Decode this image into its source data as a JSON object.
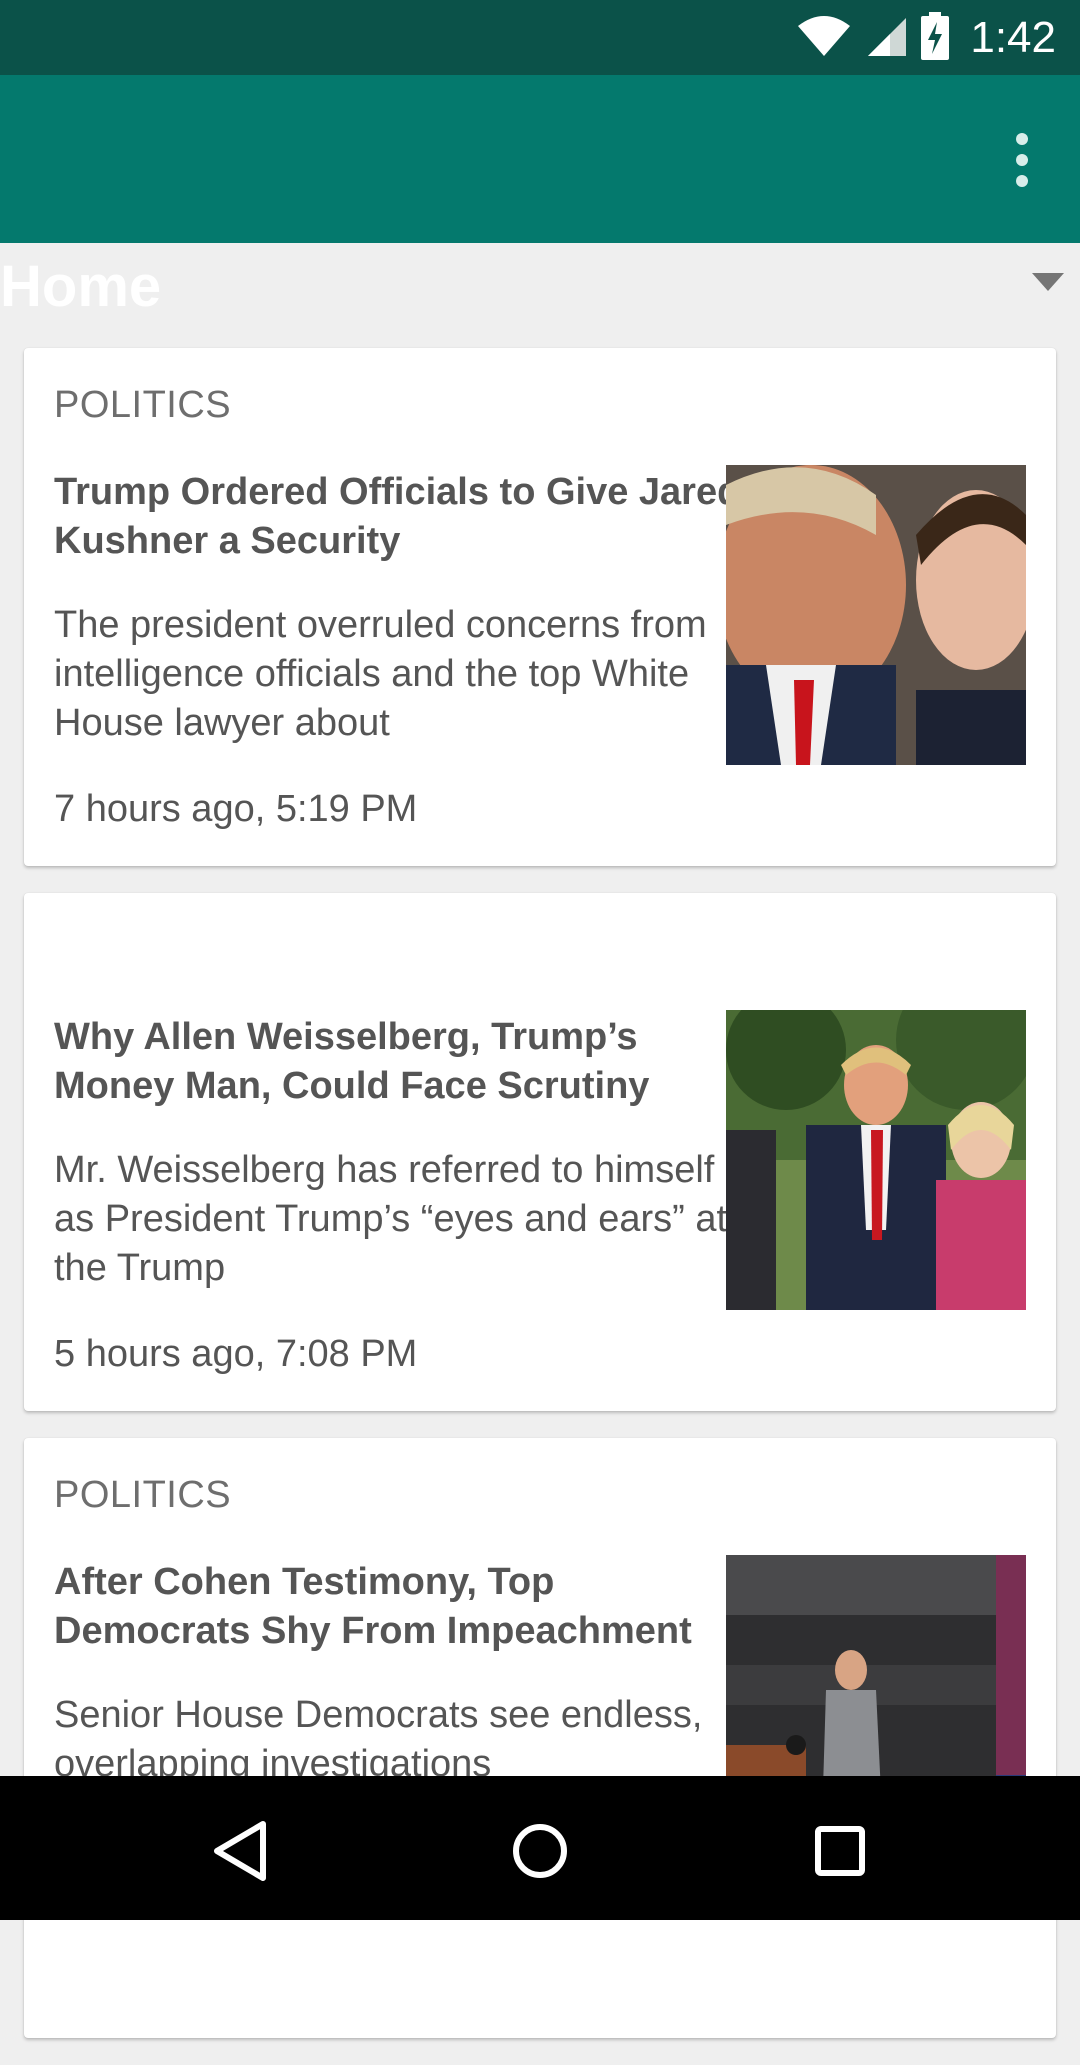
{
  "status_bar": {
    "time": "1:42"
  },
  "section": {
    "title": "Home"
  },
  "articles": [
    {
      "kicker": "POLITICS",
      "headline": "Trump Ordered Officials to Give Jared Kushner a Security",
      "summary": "The president overruled concerns from intelligence officials and the top White House lawyer about",
      "timestamp": "7 hours ago, 5:19 PM"
    },
    {
      "kicker": "",
      "headline": "Why Allen Weisselberg, Trump’s Money Man, Could Face Scrutiny",
      "summary": "Mr. Weisselberg has referred to himself as President Trump’s “eyes and ears” at the Trump",
      "timestamp": "5 hours ago, 7:08 PM"
    },
    {
      "kicker": "POLITICS",
      "headline": "After Cohen Testimony, Top Democrats Shy From Impeachment",
      "summary": "Senior House Democrats see endless, overlapping investigations",
      "timestamp": ""
    }
  ],
  "colors": {
    "status_bar": "#0B5249",
    "app_bar": "#04796D",
    "background": "#EFEFEF"
  },
  "icons": {
    "wifi": "wifi-icon",
    "signal": "cell-signal-icon",
    "battery": "battery-charging-icon",
    "overflow": "more-vert-icon",
    "dropdown": "arrow-drop-down-icon",
    "back": "back-triangle-icon",
    "home": "home-circle-icon",
    "recents": "recents-square-icon"
  }
}
